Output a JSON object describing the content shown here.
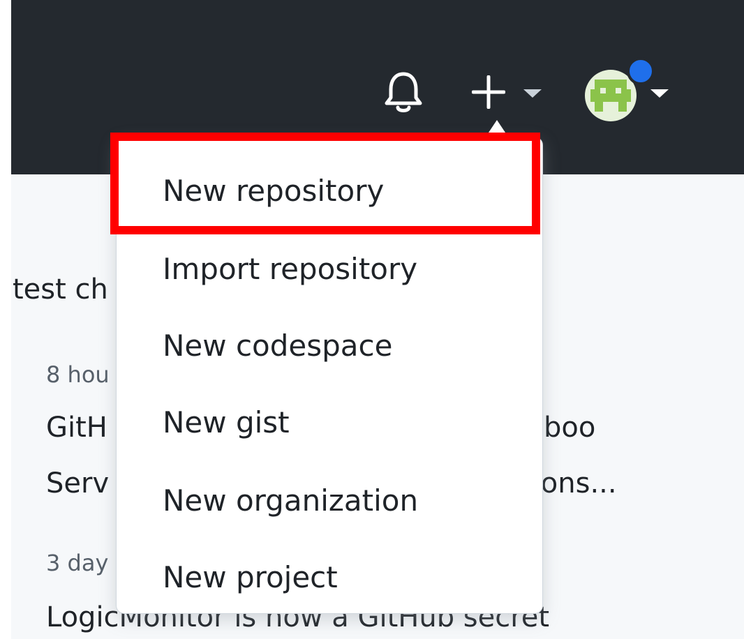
{
  "header": {
    "notifications_icon": "bell-icon",
    "create_icon": "plus-icon",
    "create_caret_icon": "caret-down-icon",
    "avatar_icon": "avatar",
    "avatar_caret_icon": "caret-down-icon",
    "notification_dot_color": "#1f6feb",
    "background_color": "#24292f"
  },
  "dropdown": {
    "items": [
      {
        "label": "New repository"
      },
      {
        "label": "Import repository"
      },
      {
        "label": "New codespace"
      },
      {
        "label": "New gist"
      },
      {
        "label": "New organization"
      },
      {
        "label": "New project"
      }
    ],
    "highlighted_item": "New repository",
    "highlight_color": "#ff0000"
  },
  "feed": {
    "title_fragment": "test ch",
    "entries": [
      {
        "time_fragment": "8 hou",
        "line1_left": "GitH",
        "line1_right": "mboo",
        "line2_left": "Serv",
        "line2_right": "tions..."
      },
      {
        "time_fragment": "3 day",
        "line1": "LogicMonitor is now a GitHub secret"
      }
    ]
  }
}
